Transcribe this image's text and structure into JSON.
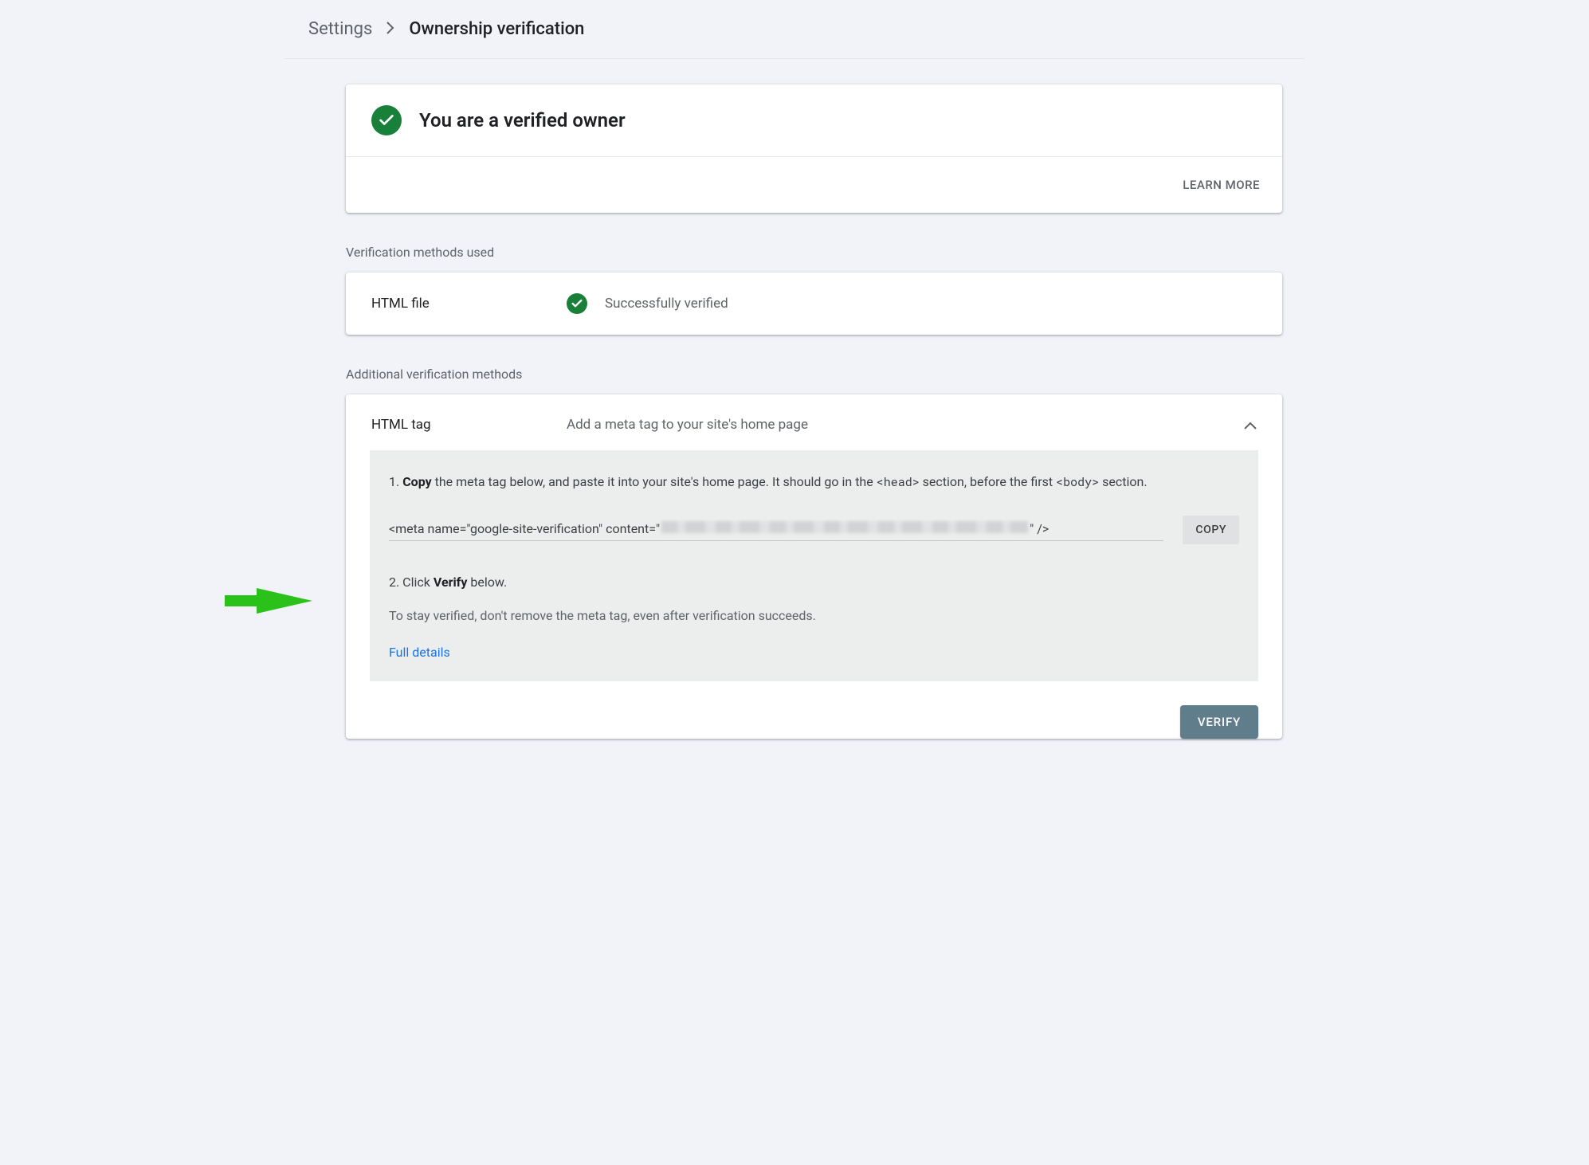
{
  "breadcrumb": {
    "settings": "Settings",
    "current": "Ownership verification"
  },
  "status_card": {
    "title": "You are a verified owner",
    "learn_more": "LEARN MORE"
  },
  "sections": {
    "used_label": "Verification methods used",
    "additional_label": "Additional verification methods"
  },
  "used_method": {
    "name": "HTML file",
    "status": "Successfully verified"
  },
  "html_tag_method": {
    "name": "HTML tag",
    "desc": "Add a meta tag to your site's home page",
    "step1_num": "1. ",
    "step1_bold": "Copy",
    "step1_rest_a": " the meta tag below, and paste it into your site's home page. It should go in the ",
    "step1_code1": "<head>",
    "step1_rest_b": " section, before the first ",
    "step1_code2": "<body>",
    "step1_rest_c": " section.",
    "code_prefix": "<meta name=\"google-site-verification\" content=\"",
    "code_suffix": "\" />",
    "copy_btn": "COPY",
    "step2_num": "2. Click ",
    "step2_bold": "Verify",
    "step2_rest": " below.",
    "note": "To stay verified, don't remove the meta tag, even after verification succeeds.",
    "full_details": "Full details",
    "verify_btn": "VERIFY"
  },
  "colors": {
    "green": "#188038",
    "link": "#1a73e8",
    "verify_btn": "#607d8b",
    "arrow": "#29c11a"
  }
}
